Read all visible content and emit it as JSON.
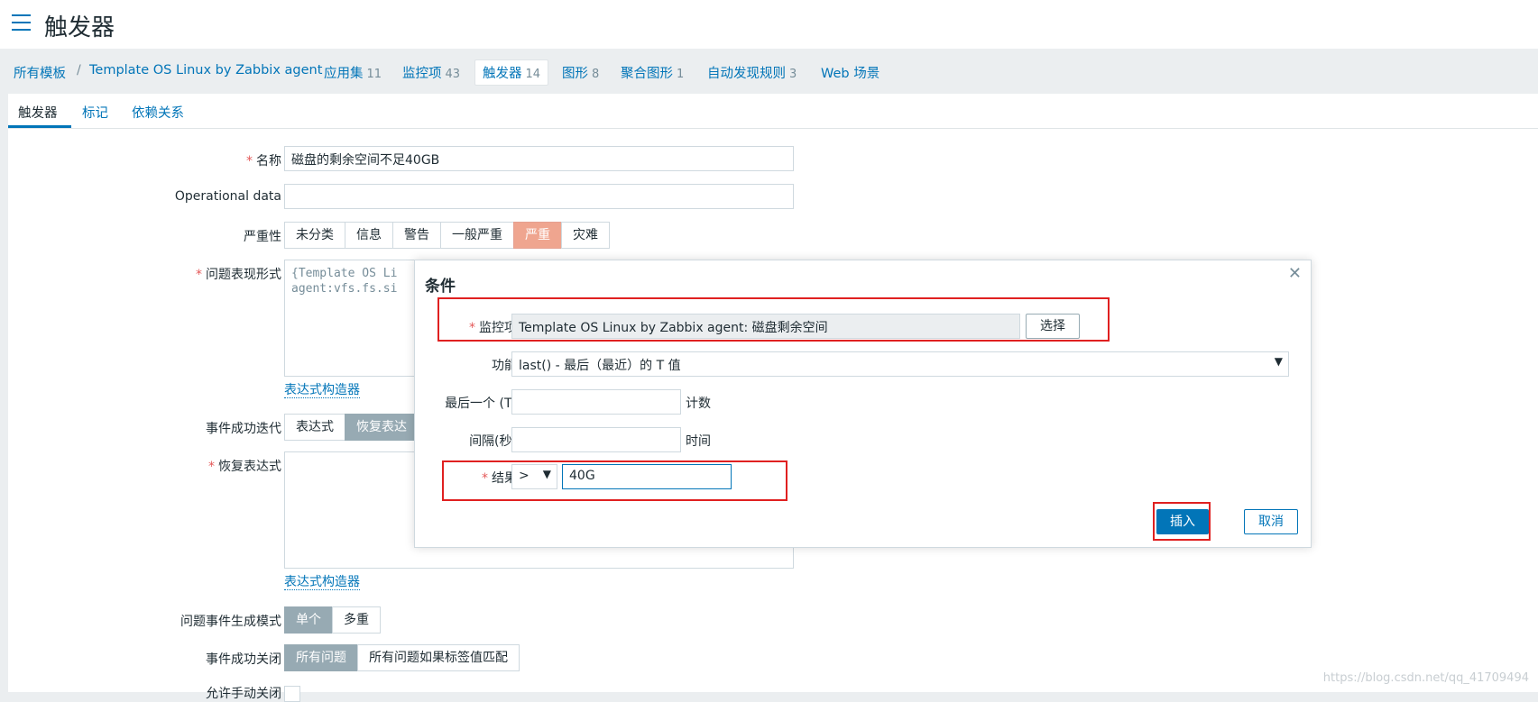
{
  "header": {
    "title": "触发器"
  },
  "breadcrumbs": {
    "all_templates": "所有模板",
    "separator": "/",
    "template": "Template OS Linux by Zabbix agent",
    "items": [
      {
        "label": "应用集",
        "count": "11"
      },
      {
        "label": "监控项",
        "count": "43"
      },
      {
        "label": "触发器",
        "count": "14"
      },
      {
        "label": "图形",
        "count": "8"
      },
      {
        "label": "聚合图形",
        "count": "1"
      },
      {
        "label": "自动发现规则",
        "count": "3"
      },
      {
        "label": "Web 场景",
        "count": ""
      }
    ]
  },
  "tabs": [
    "触发器",
    "标记",
    "依赖关系"
  ],
  "form": {
    "required_mark": "*",
    "name_label": "名称",
    "name_value": "磁盘的剩余空间不足40GB",
    "opdata_label": "Operational data",
    "opdata_value": "",
    "severity_label": "严重性",
    "severity_options": [
      "未分类",
      "信息",
      "警告",
      "一般严重",
      "严重",
      "灾难"
    ],
    "severity_selected": "严重",
    "expression_label": "问题表现形式",
    "expression_value": "{Template OS Li\nagent:vfs.fs.si",
    "expression_builder": "表达式构造器",
    "ok_event_label": "事件成功迭代",
    "ok_event_options": [
      "表达式",
      "恢复表达"
    ],
    "recovery_label": "恢复表达式",
    "recovery_builder": "表达式构造器",
    "gen_mode_label": "问题事件生成模式",
    "gen_mode_options": [
      "单个",
      "多重"
    ],
    "close_label": "事件成功关闭",
    "close_options": [
      "所有问题",
      "所有问题如果标签值匹配"
    ],
    "manual_close_label": "允许手动关闭"
  },
  "modal": {
    "title": "条件",
    "item_label": "监控项",
    "item_value": "Template OS Linux by Zabbix agent: 磁盘剩余空间",
    "select_button": "选择",
    "function_label": "功能",
    "function_value": "last() - 最后（最近）的 T 值",
    "last_label": "最后一个 (T)",
    "last_value": "",
    "last_unit": "计数",
    "interval_label": "间隔(秒)",
    "interval_value": "",
    "interval_unit": "时间",
    "result_label": "结果",
    "result_operator": ">",
    "result_value": "40G",
    "insert_button": "插入",
    "cancel_button": "取消"
  },
  "watermark": "https://blog.csdn.net/qq_41709494",
  "colors": {
    "accent": "#0275b8",
    "severity_high": "#efa58f",
    "highlight_box": "#e02020"
  }
}
